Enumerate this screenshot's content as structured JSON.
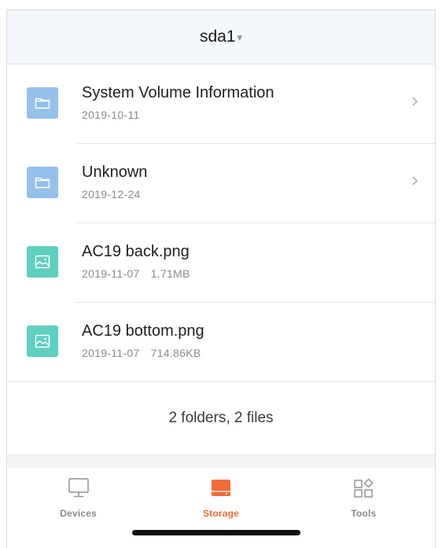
{
  "header": {
    "title": "sda1",
    "caret": "▾"
  },
  "items": [
    {
      "type": "folder",
      "name": "System Volume Information",
      "date": "2019-10-11",
      "size": ""
    },
    {
      "type": "folder",
      "name": "Unknown",
      "date": "2019-12-24",
      "size": ""
    },
    {
      "type": "image",
      "name": "AC19 back.png",
      "date": "2019-11-07",
      "size": "1.71MB"
    },
    {
      "type": "image",
      "name": "AC19 bottom.png",
      "date": "2019-11-07",
      "size": "714.86KB"
    }
  ],
  "summary": "2 folders, 2 files",
  "tabs": [
    {
      "label": "Devices",
      "icon": "monitor-icon",
      "active": false
    },
    {
      "label": "Storage",
      "icon": "storage-drive-icon",
      "active": true
    },
    {
      "label": "Tools",
      "icon": "tools-grid-icon",
      "active": false
    }
  ],
  "colors": {
    "accent": "#f26b38",
    "folder_icon_bg": "#94c0ea",
    "image_icon_bg": "#5fcfbf",
    "header_bg": "#f4f7fb"
  }
}
